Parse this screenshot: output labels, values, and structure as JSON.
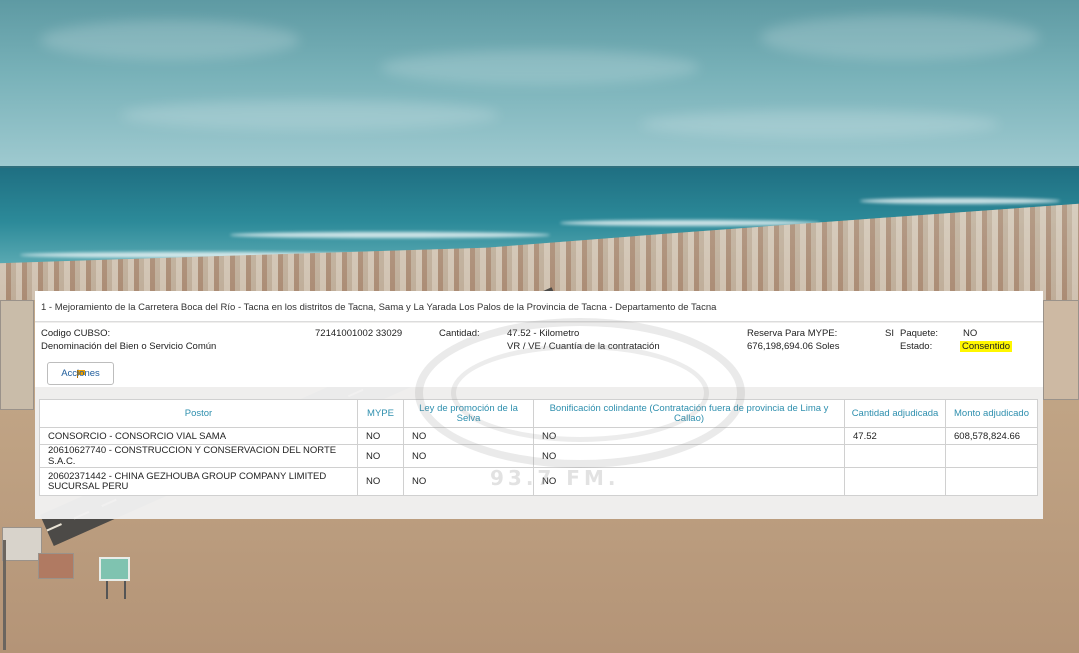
{
  "watermark": {
    "text": "93.7 FM."
  },
  "panel": {
    "title": "1 - Mejoramiento de la Carretera Boca del Río - Tacna en los distritos de Tacna, Sama y La Yarada Los Palos de la Provincia de Tacna - Departamento de Tacna",
    "info": {
      "codigo_label": "Codigo CUBSO:",
      "codigo_value": "72141001002 33029",
      "denominacion_label": "Denominación del Bien o Servicio Común",
      "cantidad_label": "Cantidad:",
      "cantidad_value": "47.52 - Kilometro",
      "vr_label": "VR / VE / Cuantía de la contratación",
      "reserva_label": "Reserva Para MYPE:",
      "reserva_value": "SI",
      "monto_value": "676,198,694.06 Soles",
      "paquete_label": "Paquete:",
      "paquete_value": "NO",
      "estado_label": "Estado:",
      "estado_value": "Consentido"
    },
    "acciones_label": "Acciones"
  },
  "table": {
    "headers": {
      "postor": "Postor",
      "mype": "MYPE",
      "ley_selva": "Ley de promoción de la Selva",
      "bonificacion": "Bonificación colindante (Contratación fuera de provincia de Lima y Callao)",
      "cantidad": "Cantidad adjudicada",
      "monto": "Monto adjudicado"
    },
    "rows": [
      {
        "postor": "CONSORCIO - CONSORCIO VIAL SAMA",
        "mype": "NO",
        "ley": "NO",
        "bonif": "NO",
        "cantidad": "47.52",
        "monto": "608,578,824.66"
      },
      {
        "postor": "20610627740 - CONSTRUCCION Y CONSERVACION DEL NORTE S.A.C.",
        "mype": "NO",
        "ley": "NO",
        "bonif": "NO",
        "cantidad": "",
        "monto": ""
      },
      {
        "postor": "20602371442 - CHINA GEZHOUBA GROUP COMPANY LIMITED SUCURSAL PERU",
        "mype": "NO",
        "ley": "NO",
        "bonif": "NO",
        "cantidad": "",
        "monto": ""
      }
    ]
  },
  "colors": {
    "header_text": "#2e8fae",
    "status_highlight": "#fff700",
    "button_text": "#1f5d9c"
  },
  "icons": {
    "acciones": "flag-icon"
  }
}
